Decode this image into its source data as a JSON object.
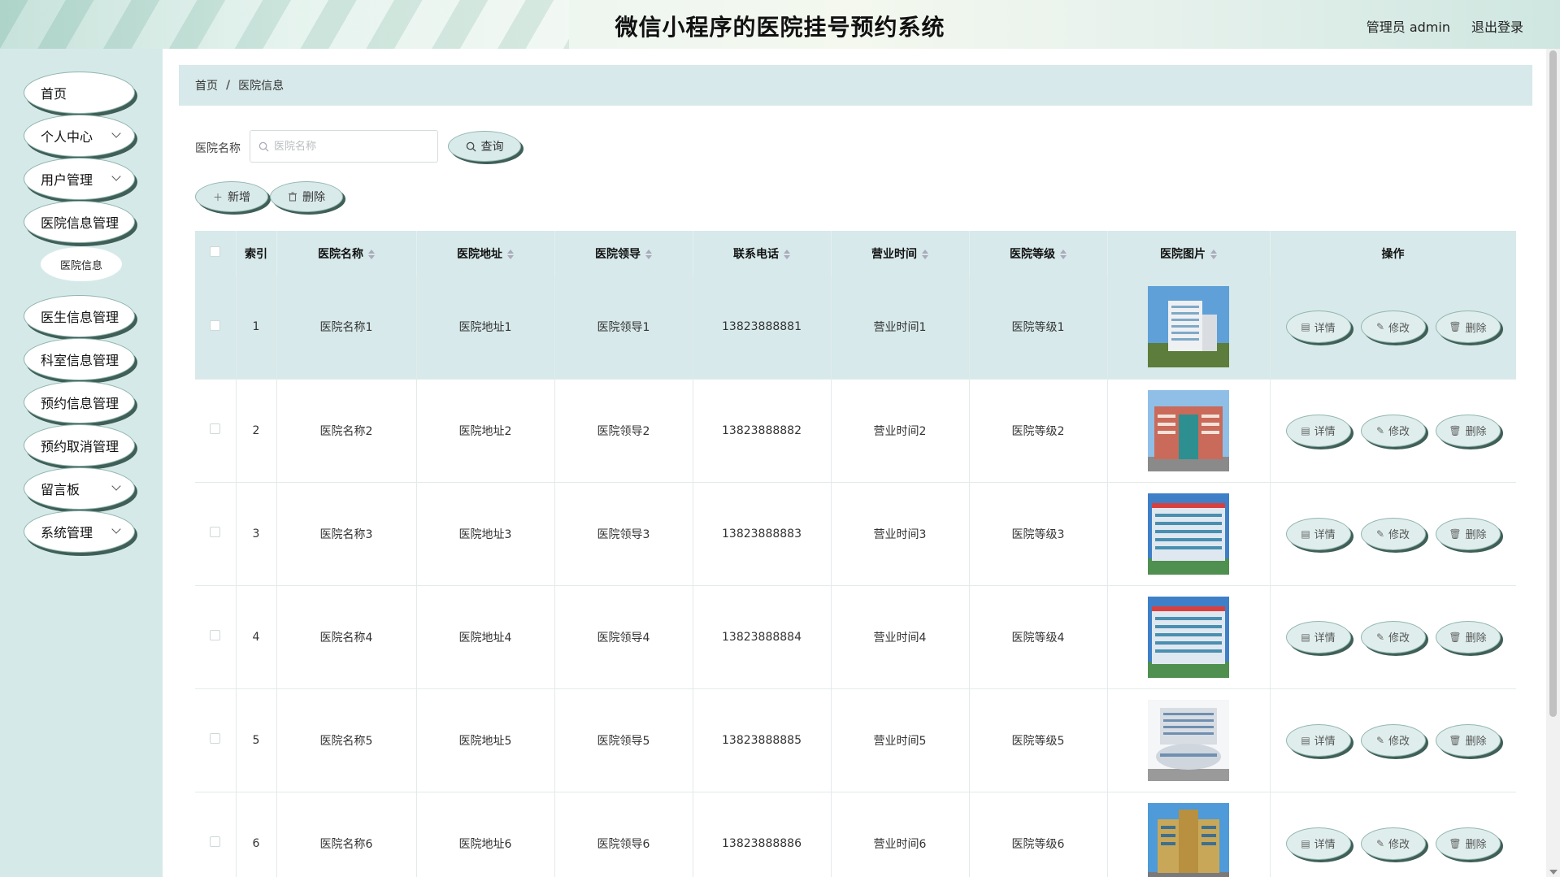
{
  "header": {
    "title": "微信小程序的医院挂号预约系统",
    "user_label": "管理员 admin",
    "logout_label": "退出登录"
  },
  "sidebar": {
    "items": [
      {
        "label": "首页",
        "has_arrow": false
      },
      {
        "label": "个人中心",
        "has_arrow": true
      },
      {
        "label": "用户管理",
        "has_arrow": true
      },
      {
        "label": "医院信息管理",
        "has_arrow": false
      },
      {
        "label": "医生信息管理",
        "has_arrow": false
      },
      {
        "label": "科室信息管理",
        "has_arrow": false
      },
      {
        "label": "预约信息管理",
        "has_arrow": false
      },
      {
        "label": "预约取消管理",
        "has_arrow": false
      },
      {
        "label": "留言板",
        "has_arrow": true
      },
      {
        "label": "系统管理",
        "has_arrow": true
      }
    ],
    "sub_item": "医院信息"
  },
  "breadcrumb": {
    "home": "首页",
    "sep": "/",
    "current": "医院信息"
  },
  "search": {
    "label": "医院名称",
    "placeholder": "医院名称",
    "button_label": "查询"
  },
  "actions": {
    "add_label": "新增",
    "delete_label": "删除"
  },
  "table": {
    "columns": [
      "索引",
      "医院名称",
      "医院地址",
      "医院领导",
      "联系电话",
      "营业时间",
      "医院等级",
      "医院图片",
      "操作"
    ],
    "op_labels": {
      "detail": "详情",
      "edit": "修改",
      "delete": "删除"
    },
    "rows": [
      {
        "index": "1",
        "name": "医院名称1",
        "address": "医院地址1",
        "leader": "医院领导1",
        "phone": "13823888881",
        "hours": "营业时间1",
        "level": "医院等级1"
      },
      {
        "index": "2",
        "name": "医院名称2",
        "address": "医院地址2",
        "leader": "医院领导2",
        "phone": "13823888882",
        "hours": "营业时间2",
        "level": "医院等级2"
      },
      {
        "index": "3",
        "name": "医院名称3",
        "address": "医院地址3",
        "leader": "医院领导3",
        "phone": "13823888883",
        "hours": "营业时间3",
        "level": "医院等级3"
      },
      {
        "index": "4",
        "name": "医院名称4",
        "address": "医院地址4",
        "leader": "医院领导4",
        "phone": "13823888884",
        "hours": "营业时间4",
        "level": "医院等级4"
      },
      {
        "index": "5",
        "name": "医院名称5",
        "address": "医院地址5",
        "leader": "医院领导5",
        "phone": "13823888885",
        "hours": "营业时间5",
        "level": "医院等级5"
      },
      {
        "index": "6",
        "name": "医院名称6",
        "address": "医院地址6",
        "leader": "医院领导6",
        "phone": "13823888886",
        "hours": "营业时间6",
        "level": "医院等级6"
      }
    ]
  },
  "colors": {
    "accent": "#d7e9ea",
    "sidebar_bg": "#d6e9e9",
    "button_shadow": "#3f5f57"
  }
}
